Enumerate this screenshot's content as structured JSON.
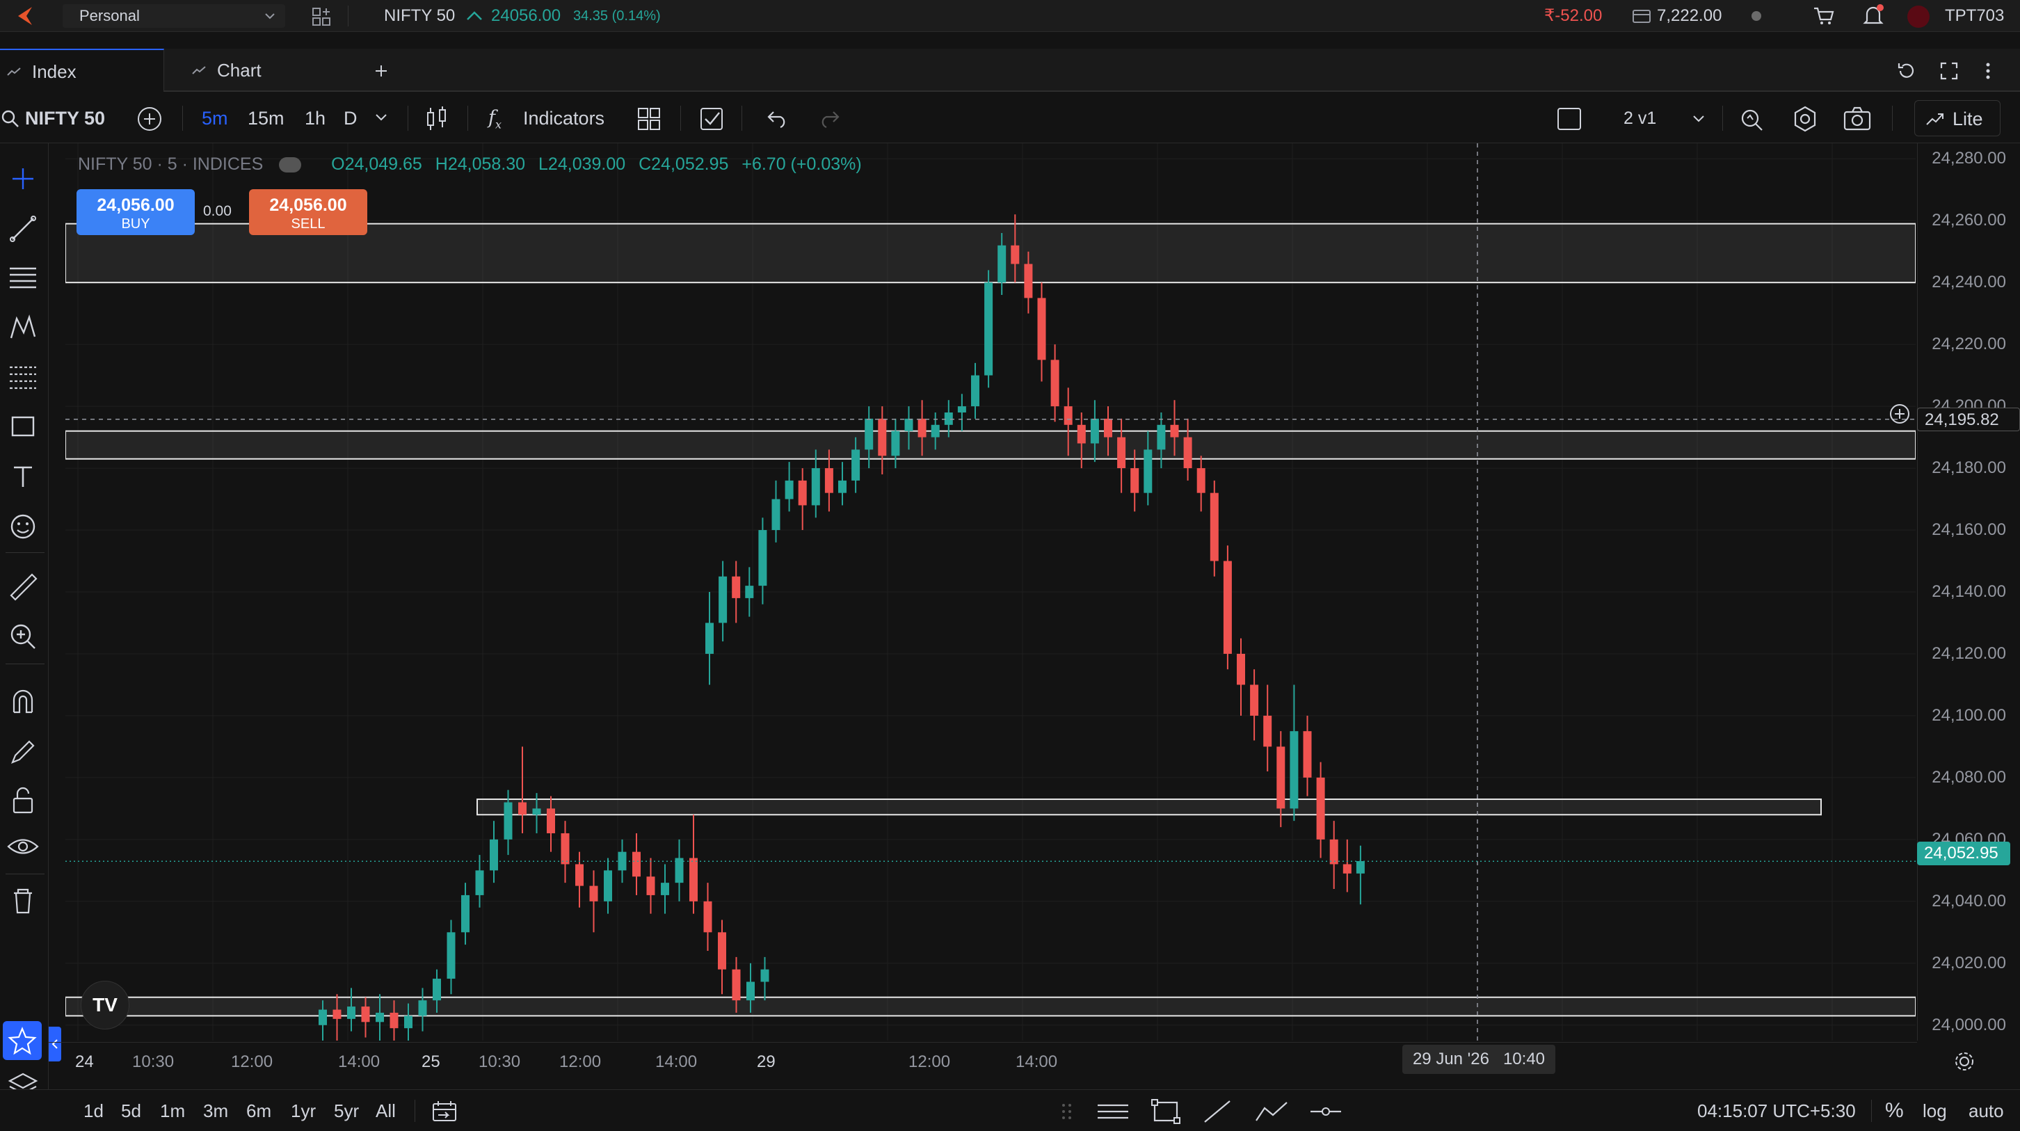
{
  "topbar": {
    "account": "Personal",
    "symbol": "NIFTY 50",
    "price": "24056.00",
    "change": "34.35 (0.14%)",
    "pnl": "₹-52.00",
    "funds": "7,222.00",
    "user": "TPT703"
  },
  "tabs": [
    {
      "label": "Index"
    },
    {
      "label": "Chart"
    }
  ],
  "toolbar": {
    "symbol": "NIFTY 50",
    "intervals": [
      "5m",
      "15m",
      "1h",
      "D"
    ],
    "active_interval": "5m",
    "indicators": "Indicators",
    "layout": "2 v1",
    "lite": "Lite"
  },
  "legend": {
    "title": "NIFTY 50 · 5 · INDICES",
    "open": "O24,049.65",
    "high": "H24,058.30",
    "low": "L24,039.00",
    "close": "C24,052.95",
    "change": "+6.70 (+0.03%)"
  },
  "trade": {
    "buy_price": "24,056.00",
    "buy_label": "BUY",
    "spread": "0.00",
    "sell_price": "24,056.00",
    "sell_label": "SELL"
  },
  "price_axis": [
    "24,280.00",
    "24,260.00",
    "24,240.00",
    "24,220.00",
    "24,200.00",
    "24,180.00",
    "24,160.00",
    "24,140.00",
    "24,120.00",
    "24,100.00",
    "24,080.00",
    "24,060.00",
    "24,040.00",
    "24,020.00",
    "24,000.00"
  ],
  "crosshair_price": "24,195.82",
  "last_price": "24,052.95",
  "time_axis": [
    "24",
    "10:30",
    "12:00",
    "14:00",
    "25",
    "10:30",
    "12:00",
    "14:00",
    "29",
    "12:00",
    "14:00"
  ],
  "crosshair_time": "29 Jun '26   10:40",
  "bottombar": {
    "ranges": [
      "1d",
      "5d",
      "1m",
      "3m",
      "6m",
      "1yr",
      "5yr",
      "All"
    ],
    "clock": "04:15:07 UTC+5:30",
    "pct": "%",
    "log": "log",
    "auto": "auto"
  },
  "colors": {
    "up": "#26a69a",
    "down": "#ef5350",
    "accent": "#2962ff",
    "buy": "#3b82f6",
    "sell": "#e0643e"
  },
  "chart_data": {
    "type": "candlestick",
    "title": "NIFTY 50 · 5 · INDICES",
    "ylim": [
      23995,
      24285
    ],
    "zones": [
      {
        "low": 24240,
        "high": 24259
      },
      {
        "low": 24183,
        "high": 24192
      },
      {
        "low": 24068,
        "high": 24073
      },
      {
        "low": 24003,
        "high": 24009
      }
    ],
    "candles": [
      [
        24000,
        24005,
        23992,
        24008
      ],
      [
        24005,
        24002,
        23995,
        24010
      ],
      [
        24002,
        24006,
        23998,
        24012
      ],
      [
        24006,
        24001,
        23996,
        24009
      ],
      [
        24001,
        24004,
        23994,
        24010
      ],
      [
        24004,
        23999,
        23995,
        24008
      ],
      [
        23999,
        24003,
        23994,
        24007
      ],
      [
        24003,
        24008,
        23998,
        24012
      ],
      [
        24008,
        24015,
        24004,
        24018
      ],
      [
        24015,
        24030,
        24010,
        24034
      ],
      [
        24030,
        24042,
        24026,
        24046
      ],
      [
        24042,
        24050,
        24038,
        24055
      ],
      [
        24050,
        24060,
        24046,
        24066
      ],
      [
        24060,
        24072,
        24055,
        24076
      ],
      [
        24072,
        24068,
        24062,
        24090
      ],
      [
        24068,
        24070,
        24062,
        24075
      ],
      [
        24070,
        24062,
        24056,
        24074
      ],
      [
        24062,
        24052,
        24046,
        24066
      ],
      [
        24052,
        24045,
        24038,
        24056
      ],
      [
        24045,
        24040,
        24030,
        24050
      ],
      [
        24040,
        24050,
        24036,
        24054
      ],
      [
        24050,
        24056,
        24046,
        24060
      ],
      [
        24056,
        24048,
        24042,
        24062
      ],
      [
        24048,
        24042,
        24036,
        24054
      ],
      [
        24042,
        24046,
        24036,
        24052
      ],
      [
        24046,
        24054,
        24040,
        24060
      ],
      [
        24054,
        24040,
        24036,
        24068
      ],
      [
        24040,
        24030,
        24024,
        24046
      ],
      [
        24030,
        24018,
        24010,
        24034
      ],
      [
        24018,
        24008,
        24004,
        24022
      ],
      [
        24008,
        24014,
        24004,
        24020
      ],
      [
        24014,
        24018,
        24008,
        24022
      ],
      [
        24120,
        24130,
        24110,
        24140
      ],
      [
        24130,
        24145,
        24124,
        24150
      ],
      [
        24145,
        24138,
        24130,
        24150
      ],
      [
        24138,
        24142,
        24132,
        24148
      ],
      [
        24142,
        24160,
        24136,
        24164
      ],
      [
        24160,
        24170,
        24156,
        24176
      ],
      [
        24170,
        24176,
        24166,
        24182
      ],
      [
        24176,
        24168,
        24160,
        24180
      ],
      [
        24168,
        24180,
        24164,
        24186
      ],
      [
        24180,
        24172,
        24166,
        24186
      ],
      [
        24172,
        24176,
        24168,
        24182
      ],
      [
        24176,
        24186,
        24172,
        24190
      ],
      [
        24186,
        24196,
        24180,
        24200
      ],
      [
        24196,
        24184,
        24178,
        24200
      ],
      [
        24184,
        24192,
        24180,
        24196
      ],
      [
        24192,
        24196,
        24186,
        24200
      ],
      [
        24196,
        24190,
        24184,
        24202
      ],
      [
        24190,
        24194,
        24186,
        24198
      ],
      [
        24194,
        24198,
        24190,
        24202
      ],
      [
        24198,
        24200,
        24192,
        24204
      ],
      [
        24200,
        24210,
        24196,
        24214
      ],
      [
        24210,
        24240,
        24206,
        24244
      ],
      [
        24240,
        24252,
        24236,
        24256
      ],
      [
        24252,
        24246,
        24240,
        24262
      ],
      [
        24246,
        24235,
        24230,
        24250
      ],
      [
        24235,
        24215,
        24208,
        24240
      ],
      [
        24215,
        24200,
        24195,
        24220
      ],
      [
        24200,
        24194,
        24184,
        24206
      ],
      [
        24194,
        24188,
        24180,
        24198
      ],
      [
        24188,
        24196,
        24182,
        24202
      ],
      [
        24196,
        24190,
        24184,
        24200
      ],
      [
        24190,
        24180,
        24172,
        24196
      ],
      [
        24180,
        24172,
        24166,
        24186
      ],
      [
        24172,
        24186,
        24168,
        24192
      ],
      [
        24186,
        24194,
        24180,
        24198
      ],
      [
        24194,
        24190,
        24184,
        24202
      ],
      [
        24190,
        24180,
        24176,
        24196
      ],
      [
        24180,
        24172,
        24166,
        24184
      ],
      [
        24172,
        24150,
        24145,
        24176
      ],
      [
        24150,
        24120,
        24115,
        24155
      ],
      [
        24120,
        24110,
        24100,
        24125
      ],
      [
        24110,
        24100,
        24092,
        24115
      ],
      [
        24100,
        24090,
        24082,
        24110
      ],
      [
        24090,
        24070,
        24064,
        24095
      ],
      [
        24070,
        24095,
        24066,
        24110
      ],
      [
        24095,
        24080,
        24074,
        24100
      ],
      [
        24080,
        24060,
        24054,
        24085
      ],
      [
        24060,
        24052,
        24044,
        24066
      ],
      [
        24052,
        24049,
        24043,
        24060
      ],
      [
        24049,
        24053,
        24039,
        24058
      ]
    ]
  }
}
